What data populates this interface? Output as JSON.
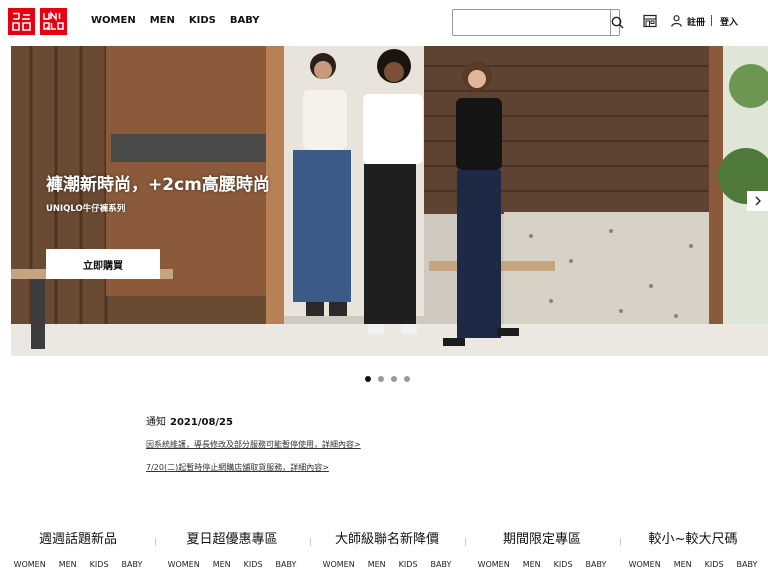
{
  "header": {
    "logo_top": "ユニクロ",
    "logo_bottom": "UNIQLO",
    "nav": [
      "WOMEN",
      "MEN",
      "KIDS",
      "BABY"
    ],
    "search_placeholder": "",
    "register": "註冊",
    "login": "登入"
  },
  "hero": {
    "title": "褲潮新時尚，+2cm高腰時尚",
    "subtitle": "UNIQLO牛仔褲系列",
    "cta": "立即購買",
    "slide_count": 4,
    "active_slide": 1
  },
  "notice": {
    "label": "通知",
    "date": "2021/08/25",
    "links": [
      "因系統維護，導長修改及部分服務可能暫停使用，詳細內容>",
      "7/20(二)起暫時停止網購店舖取貨服務，詳細內容>"
    ]
  },
  "categories": [
    {
      "title": "週週話題新品",
      "links": [
        "WOMEN",
        "MEN",
        "KIDS",
        "BABY"
      ]
    },
    {
      "title": "夏日超優惠專區",
      "links": [
        "WOMEN",
        "MEN",
        "KIDS",
        "BABY"
      ]
    },
    {
      "title": "大師級聯名新降價",
      "links": [
        "WOMEN",
        "MEN",
        "KIDS",
        "BABY"
      ]
    },
    {
      "title": "期間限定專區",
      "links": [
        "WOMEN",
        "MEN",
        "KIDS",
        "BABY"
      ]
    },
    {
      "title": "較小~較大尺碼",
      "links": [
        "WOMEN",
        "MEN",
        "KIDS",
        "BABY"
      ]
    }
  ],
  "colors": {
    "brand_red": "#e60012",
    "dot_active": "#111111",
    "dot_inactive": "#999999"
  }
}
